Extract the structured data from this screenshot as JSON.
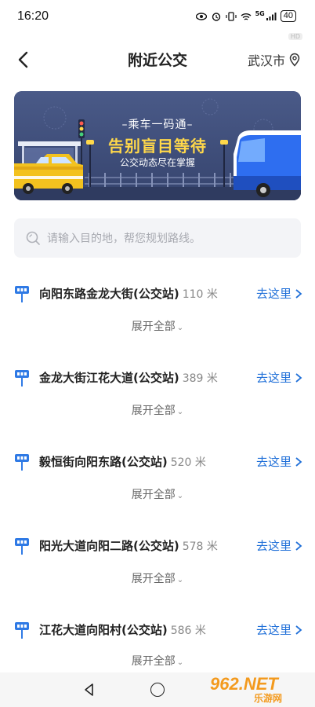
{
  "status_bar": {
    "time": "16:20",
    "battery": "40",
    "network": "5G",
    "hd_badge": "HD"
  },
  "header": {
    "title": "附近公交",
    "city": "武汉市",
    "back_icon": "back-arrow-icon",
    "location_icon": "location-pin-icon"
  },
  "banner": {
    "line1": "–乘车一码通–",
    "line2": "告别盲目等待",
    "line3": "公交动态尽在掌握"
  },
  "search": {
    "placeholder": "请输入目的地，帮您规划路线。"
  },
  "stops": [
    {
      "name": "向阳东路金龙大街(公交站)",
      "distance": "110 米",
      "action": "去这里",
      "expand": "展开全部"
    },
    {
      "name": "金龙大街江花大道(公交站)",
      "distance": "389 米",
      "action": "去这里",
      "expand": "展开全部"
    },
    {
      "name": "毅恒街向阳东路(公交站)",
      "distance": "520 米",
      "action": "去这里",
      "expand": "展开全部"
    },
    {
      "name": "阳光大道向阳二路(公交站)",
      "distance": "578 米",
      "action": "去这里",
      "expand": "展开全部"
    },
    {
      "name": "江花大道向阳村(公交站)",
      "distance": "586 米",
      "action": "去这里",
      "expand": "展开全部"
    }
  ],
  "watermark": {
    "big": "962.NET",
    "small": "乐游网"
  },
  "colors": {
    "accent": "#1f6fd8",
    "banner_bg": "#3f4f7a",
    "banner_highlight": "#ffd84a"
  }
}
